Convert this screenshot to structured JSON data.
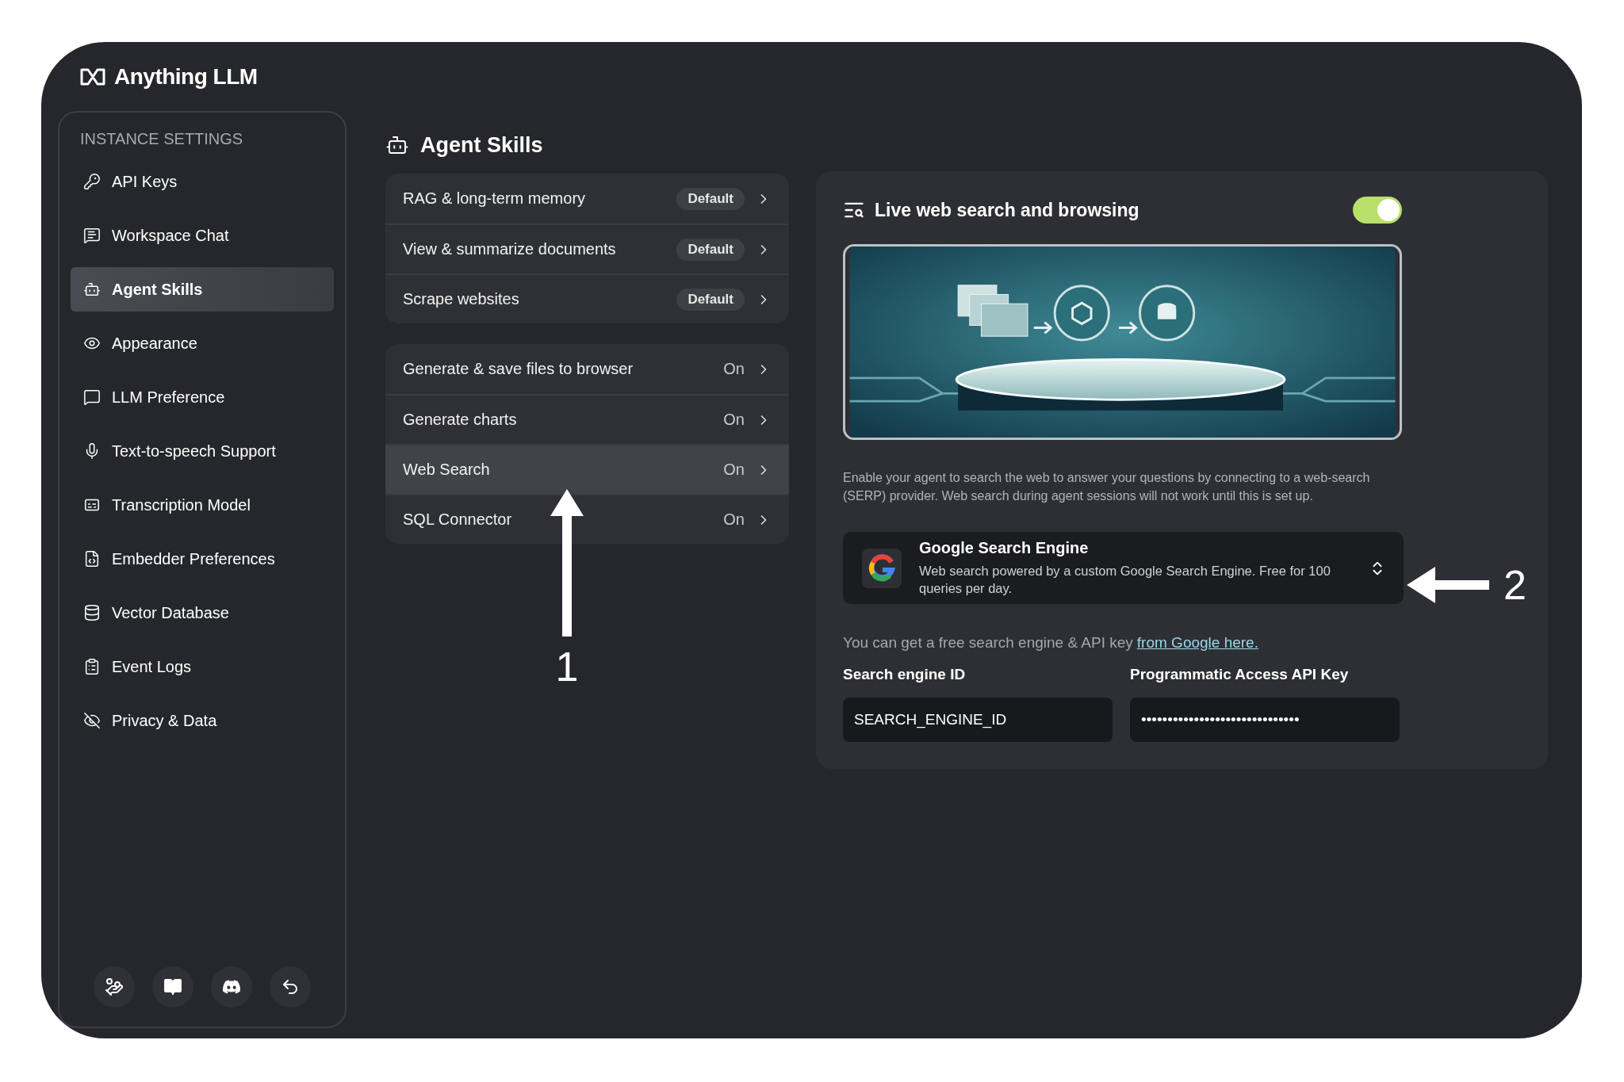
{
  "app": {
    "name": "Anything LLM"
  },
  "sidebar": {
    "heading": "INSTANCE SETTINGS",
    "items": [
      {
        "label": "API Keys",
        "selected": false
      },
      {
        "label": "Workspace Chat",
        "selected": false
      },
      {
        "label": "Agent Skills",
        "selected": true
      },
      {
        "label": "Appearance",
        "selected": false
      },
      {
        "label": "LLM Preference",
        "selected": false
      },
      {
        "label": "Text-to-speech Support",
        "selected": false
      },
      {
        "label": "Transcription Model",
        "selected": false
      },
      {
        "label": "Embedder Preferences",
        "selected": false
      },
      {
        "label": "Vector Database",
        "selected": false
      },
      {
        "label": "Event Logs",
        "selected": false
      },
      {
        "label": "Privacy & Data",
        "selected": false
      }
    ]
  },
  "page": {
    "title": "Agent Skills"
  },
  "skill_groups": [
    [
      {
        "label": "RAG & long-term memory",
        "status": "Default",
        "kind": "badge",
        "selected": false
      },
      {
        "label": "View & summarize documents",
        "status": "Default",
        "kind": "badge",
        "selected": false
      },
      {
        "label": "Scrape websites",
        "status": "Default",
        "kind": "badge",
        "selected": false
      }
    ],
    [
      {
        "label": "Generate & save files to browser",
        "status": "On",
        "kind": "text",
        "selected": false
      },
      {
        "label": "Generate charts",
        "status": "On",
        "kind": "text",
        "selected": false
      },
      {
        "label": "Web Search",
        "status": "On",
        "kind": "text",
        "selected": true
      },
      {
        "label": "SQL Connector",
        "status": "On",
        "kind": "text",
        "selected": false
      }
    ]
  ],
  "web_search": {
    "title": "Live web search and browsing",
    "enabled": true,
    "description": "Enable your agent to search the web to answer your questions by connecting to a web-search (SERP) provider. Web search during agent sessions will not work until this is set up.",
    "provider": {
      "name": "Google Search Engine",
      "description": "Web search powered by a custom Google Search Engine. Free for 100 queries per day."
    },
    "hint": {
      "text": "You can get a free search engine & API key",
      "link": "from Google here."
    },
    "fields": [
      {
        "label": "Search engine ID",
        "value": "SEARCH_ENGINE_ID"
      },
      {
        "label": "Programmatic Access API Key",
        "value": "••••••••••••••••••••••••••••••"
      }
    ]
  },
  "annotations": [
    {
      "label": "1",
      "kind": "up"
    },
    {
      "label": "2",
      "kind": "left"
    }
  ]
}
